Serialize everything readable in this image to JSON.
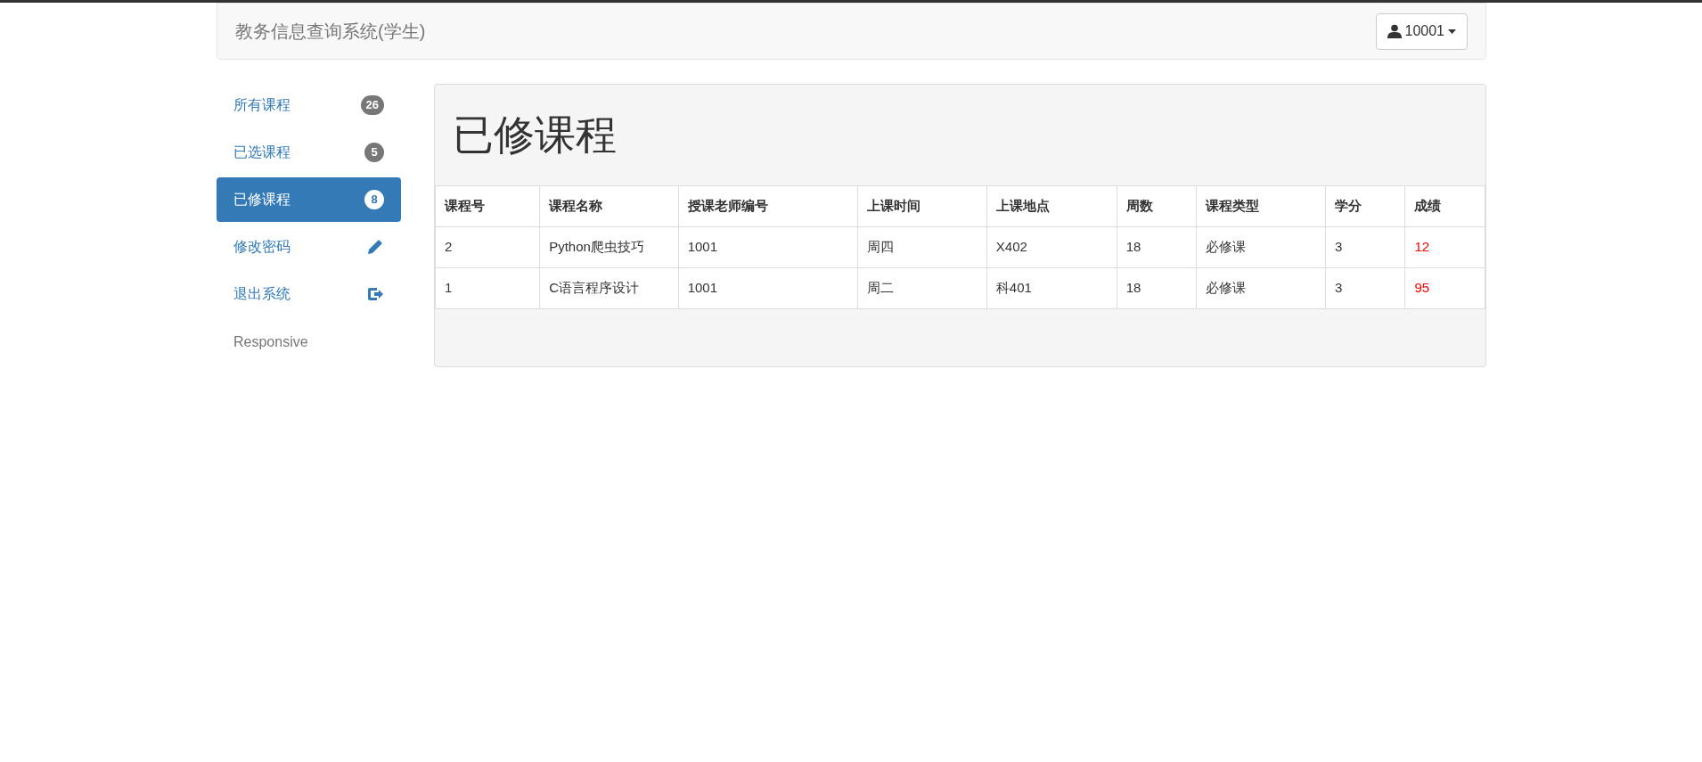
{
  "navbar": {
    "title": "教务信息查询系统(学生)",
    "user_button": "10001"
  },
  "sidebar": {
    "items": [
      {
        "label": "所有课程",
        "kind": "badge",
        "badge": "26",
        "selected": false
      },
      {
        "label": "已选课程",
        "kind": "badge",
        "badge": "5",
        "selected": false
      },
      {
        "label": "已修课程",
        "kind": "badge",
        "badge": "8",
        "selected": true
      },
      {
        "label": "修改密码",
        "kind": "pencil",
        "selected": false
      },
      {
        "label": "退出系统",
        "kind": "logout",
        "selected": false
      }
    ],
    "footer": "Responsive"
  },
  "panel": {
    "title": "已修课程",
    "table": {
      "columns": [
        "课程号",
        "课程名称",
        "授课老师编号",
        "上课时间",
        "上课地点",
        "周数",
        "课程类型",
        "学分",
        "成绩"
      ],
      "rows": [
        [
          "2",
          "Python爬虫技巧",
          "1001",
          "周四",
          "X402",
          "18",
          "必修课",
          "3",
          "12"
        ],
        [
          "1",
          "C语言程序设计",
          "1001",
          "周二",
          "科401",
          "18",
          "必修课",
          "3",
          "95"
        ]
      ]
    }
  }
}
